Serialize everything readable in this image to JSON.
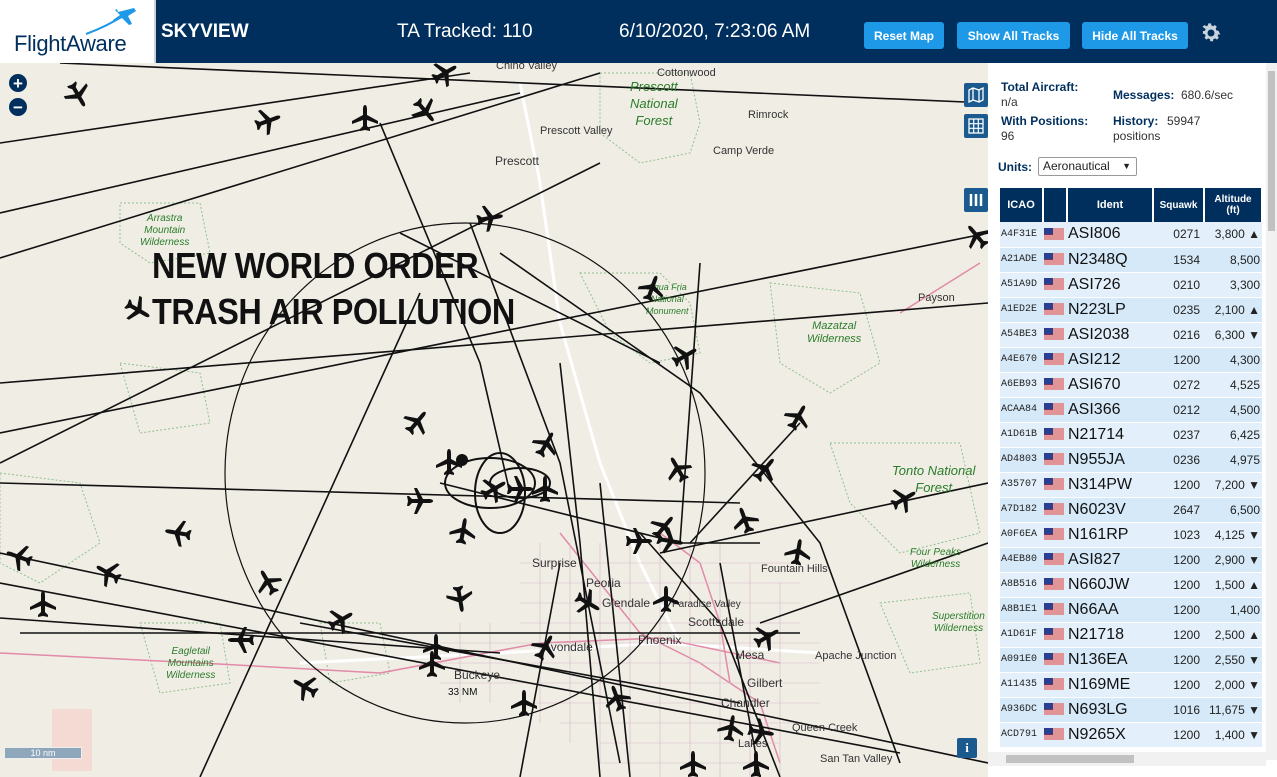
{
  "header": {
    "logo_text": "FlightAware",
    "site_name": "SKYVIEW",
    "ta_tracked": "TA Tracked: 110",
    "clock": "6/10/2020, 7:23:06 AM",
    "reset_map": "Reset Map",
    "show_all_tracks": "Show All Tracks",
    "hide_all_tracks": "Hide All Tracks"
  },
  "map": {
    "overlay_line1": "NEW WORLD ORDER",
    "overlay_line2": "TRASH AIR POLLUTION",
    "range_label": "33 NM",
    "scale_label": "10 nm",
    "zoom_in": "+",
    "zoom_out": "−",
    "info": "i",
    "towns": {
      "chino_valley": "Chino Valley",
      "cottonwood": "Cottonwood",
      "rimrock": "Rimrock",
      "prescott_valley": "Prescott Valley",
      "camp_verde": "Camp Verde",
      "prescott": "Prescott",
      "payson": "Payson",
      "fountain_hills": "Fountain Hills",
      "surprise": "Surprise",
      "peoria": "Peoria",
      "glendale": "Glendale",
      "paradise_valley": "Paradise Valley",
      "scottsdale": "Scottsdale",
      "phoenix": "Phoenix",
      "avondale": "Avondale",
      "mesa": "Mesa",
      "apache_junction": "Apache Junction",
      "buckeye": "Buckeye",
      "gilbert": "Gilbert",
      "chandler": "Chandler",
      "queen_creek": "Queen Creek",
      "casa_lakes": "Lakes",
      "san_tan_valley": "San Tan Valley"
    },
    "forests": {
      "prescott_nf": [
        "Prescott",
        "National",
        "Forest"
      ],
      "tonto_nf": [
        "Tonto National",
        "Forest"
      ]
    },
    "wilderness": {
      "arrastra": [
        "Arrastra",
        "Mountain",
        "Wilderness"
      ],
      "agua_fria": [
        "Agua Fria",
        "National",
        "Monument"
      ],
      "mazatzal": [
        "Mazatzal",
        "Wilderness"
      ],
      "four_peaks": [
        "Four Peaks",
        "Wilderness"
      ],
      "superstition": [
        "Superstition",
        "Wilderness"
      ],
      "eagletail": [
        "Eagletail",
        "Mountains",
        "Wilderness"
      ]
    }
  },
  "stats": {
    "total_label": "Total Aircraft:",
    "total_value": "n/a",
    "positions_label": "With Positions:",
    "positions_value": "96",
    "messages_label": "Messages:",
    "messages_value": "680.6/sec",
    "history_label": "History:",
    "history_value": "59947",
    "history_unit": "positions",
    "units_label": "Units:",
    "units_value": "Aeronautical"
  },
  "table": {
    "headers": {
      "icao": "ICAO",
      "ident": "Ident",
      "squawk": "Squawk",
      "altitude_line1": "Altitude",
      "altitude_line2": "(ft)"
    },
    "rows": [
      {
        "icao": "A4F31E",
        "ident": "ASI806",
        "squawk": "0271",
        "alt": "3,800 ▲"
      },
      {
        "icao": "A21ADE",
        "ident": "N2348Q",
        "squawk": "1534",
        "alt": "8,500"
      },
      {
        "icao": "A51A9D",
        "ident": "ASI726",
        "squawk": "0210",
        "alt": "3,300"
      },
      {
        "icao": "A1ED2E",
        "ident": "N223LP",
        "squawk": "0235",
        "alt": "2,100 ▲"
      },
      {
        "icao": "A54BE3",
        "ident": "ASI2038",
        "squawk": "0216",
        "alt": "6,300 ▼"
      },
      {
        "icao": "A4E670",
        "ident": "ASI212",
        "squawk": "1200",
        "alt": "4,300"
      },
      {
        "icao": "A6EB93",
        "ident": "ASI670",
        "squawk": "0272",
        "alt": "4,525"
      },
      {
        "icao": "ACAA84",
        "ident": "ASI366",
        "squawk": "0212",
        "alt": "4,500"
      },
      {
        "icao": "A1D61B",
        "ident": "N21714",
        "squawk": "0237",
        "alt": "6,425"
      },
      {
        "icao": "AD4803",
        "ident": "N955JA",
        "squawk": "0236",
        "alt": "4,975"
      },
      {
        "icao": "A35707",
        "ident": "N314PW",
        "squawk": "1200",
        "alt": "7,200 ▼"
      },
      {
        "icao": "A7D182",
        "ident": "N6023V",
        "squawk": "2647",
        "alt": "6,500"
      },
      {
        "icao": "A0F6EA",
        "ident": "N161RP",
        "squawk": "1023",
        "alt": "4,125 ▼"
      },
      {
        "icao": "A4EB80",
        "ident": "ASI827",
        "squawk": "1200",
        "alt": "2,900 ▼"
      },
      {
        "icao": "A8B516",
        "ident": "N660JW",
        "squawk": "1200",
        "alt": "1,500 ▲"
      },
      {
        "icao": "A8B1E1",
        "ident": "N66AA",
        "squawk": "1200",
        "alt": "1,400"
      },
      {
        "icao": "A1D61F",
        "ident": "N21718",
        "squawk": "1200",
        "alt": "2,500 ▲"
      },
      {
        "icao": "A091E0",
        "ident": "N136EA",
        "squawk": "1200",
        "alt": "2,550 ▼"
      },
      {
        "icao": "A11435",
        "ident": "N169ME",
        "squawk": "1200",
        "alt": "2,000 ▼"
      },
      {
        "icao": "A936DC",
        "ident": "N693LG",
        "squawk": "1016",
        "alt": "11,675 ▼"
      },
      {
        "icao": "ACD791",
        "ident": "N9265X",
        "squawk": "1200",
        "alt": "1,400 ▼"
      }
    ]
  },
  "colors": {
    "header_bg": "#002f5d",
    "button_bg": "#1d99e8",
    "row_bg": "#e3f0fb",
    "map_bg": "#f0ede5",
    "wilderness_green": "#2a7d2a"
  },
  "icons": [
    "plane-logo-icon",
    "gear-icon",
    "zoom-in-icon",
    "zoom-out-icon",
    "map-layers-icon",
    "grid-icon",
    "columns-icon",
    "info-icon",
    "us-flag-icon",
    "aircraft-icon"
  ]
}
